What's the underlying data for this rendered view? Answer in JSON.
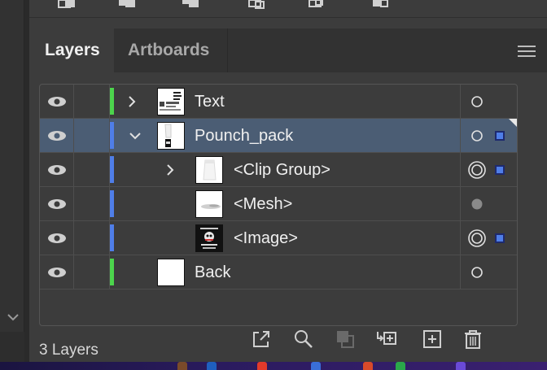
{
  "tabs": {
    "layers": "Layers",
    "artboards": "Artboards"
  },
  "layers": [
    {
      "name": "Text",
      "depth": 0,
      "color": "#4cd44c",
      "expanded": false,
      "thumb": "text-doc"
    },
    {
      "name": "Pounch_pack",
      "depth": 0,
      "color": "#4f7ee8",
      "expanded": true,
      "selected": true,
      "thumb": "pouch"
    },
    {
      "name": "<Clip Group>",
      "depth": 1,
      "color": "#4f7ee8",
      "expanded": false,
      "thumb": "pouch-white"
    },
    {
      "name": "<Mesh>",
      "depth": 1,
      "color": "#4f7ee8",
      "thumb": "mesh"
    },
    {
      "name": "<Image>",
      "depth": 1,
      "color": "#4f7ee8",
      "thumb": "label-image"
    },
    {
      "name": "Back",
      "depth": 0,
      "color": "#4cd44c",
      "thumb": "blank"
    }
  ],
  "status": {
    "count_label": "3 Layers"
  },
  "bottom_toolbar": [
    "export-icon",
    "search-icon",
    "make-clipping-mask-icon",
    "create-sublayer-icon",
    "new-layer-icon",
    "trash-icon"
  ],
  "colors": {
    "panel_bg": "#3c3c3c",
    "selected_row": "#4b5d74",
    "green_layer": "#4cd44c",
    "blue_layer": "#4f7ee8"
  }
}
